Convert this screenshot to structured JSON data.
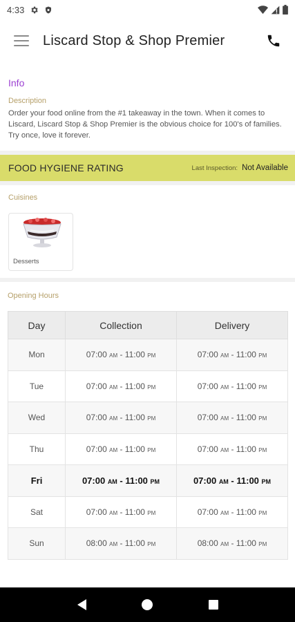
{
  "status_bar": {
    "time": "4:33",
    "icons": [
      "gear-icon",
      "shield-icon",
      "wifi-icon",
      "signal-icon",
      "battery-icon"
    ]
  },
  "app_bar": {
    "title": "Liscard Stop & Shop Premier",
    "menu_icon": "menu-icon",
    "call_icon": "phone-icon"
  },
  "info": {
    "title": "Info",
    "description_label": "Description",
    "description": "Order your food online from the #1 takeaway in the town. When it comes to Liscard, Liscard Stop & Shop Premier is the obvious choice for 100's of families. Try once, love it forever."
  },
  "hygiene": {
    "title": "FOOD HYGIENE RATING",
    "last_inspection_label": "Last Inspection:",
    "last_inspection_value": "Not Available"
  },
  "cuisines": {
    "label": "Cuisines",
    "items": [
      {
        "name": "Desserts"
      }
    ]
  },
  "opening_hours": {
    "label": "Opening Hours",
    "headers": [
      "Day",
      "Collection",
      "Delivery"
    ],
    "rows": [
      {
        "day": "Mon",
        "collection_open": "07:00",
        "collection_close": "11:00",
        "delivery_open": "07:00",
        "delivery_close": "11:00"
      },
      {
        "day": "Tue",
        "collection_open": "07:00",
        "collection_close": "11:00",
        "delivery_open": "07:00",
        "delivery_close": "11:00"
      },
      {
        "day": "Wed",
        "collection_open": "07:00",
        "collection_close": "11:00",
        "delivery_open": "07:00",
        "delivery_close": "11:00"
      },
      {
        "day": "Thu",
        "collection_open": "07:00",
        "collection_close": "11:00",
        "delivery_open": "07:00",
        "delivery_close": "11:00"
      },
      {
        "day": "Fri",
        "collection_open": "07:00",
        "collection_close": "11:00",
        "delivery_open": "07:00",
        "delivery_close": "11:00",
        "today": true
      },
      {
        "day": "Sat",
        "collection_open": "07:00",
        "collection_close": "11:00",
        "delivery_open": "07:00",
        "delivery_close": "11:00"
      },
      {
        "day": "Sun",
        "collection_open": "08:00",
        "collection_close": "11:00",
        "delivery_open": "08:00",
        "delivery_close": "11:00"
      }
    ],
    "am": "AM",
    "pm": "PM",
    "separator": " - "
  },
  "nav_bar": {
    "icons": [
      "back-icon",
      "home-icon",
      "recents-icon"
    ]
  },
  "colors": {
    "accent_purple": "#9b3fd1",
    "label_gold": "#b6a06a",
    "hygiene_yellow": "#d9dc6a"
  }
}
